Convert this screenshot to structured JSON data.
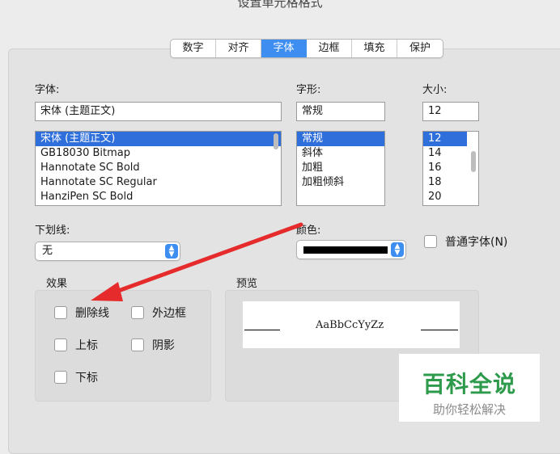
{
  "window": {
    "title": "设置单元格格式"
  },
  "tabs": [
    {
      "label": "数字"
    },
    {
      "label": "对齐"
    },
    {
      "label": "字体"
    },
    {
      "label": "边框"
    },
    {
      "label": "填充"
    },
    {
      "label": "保护"
    }
  ],
  "active_tab": "字体",
  "font": {
    "label": "字体:",
    "value": "宋体 (主题正文)",
    "options": [
      "宋体 (主题正文)",
      "GB18030 Bitmap",
      "Hannotate SC Bold",
      "Hannotate SC Regular",
      "HanziPen SC Bold"
    ]
  },
  "style": {
    "label": "字形:",
    "value": "常规",
    "options": [
      "常规",
      "斜体",
      "加粗",
      "加粗倾斜"
    ]
  },
  "size": {
    "label": "大小:",
    "value": "12",
    "options": [
      "12",
      "14",
      "16",
      "18",
      "20"
    ]
  },
  "underline": {
    "label": "下划线:",
    "value": "无"
  },
  "color": {
    "label": "颜色:",
    "swatch": "#000000"
  },
  "normal_font": {
    "label": "普通字体(N)"
  },
  "effects": {
    "label": "效果",
    "strikethrough": "删除线",
    "outline": "外边框",
    "superscript": "上标",
    "shadow": "阴影",
    "subscript": "下标"
  },
  "preview": {
    "label": "预览",
    "sample": "AaBbCcYyZz"
  },
  "watermark": {
    "title": "百科全说",
    "subtitle": "助你轻松解决"
  },
  "colors": {
    "accent": "#3d8ef0",
    "selection": "#2f6fdb",
    "arrow": "#e52b2b",
    "watermark_green": "#2e9a4b"
  }
}
